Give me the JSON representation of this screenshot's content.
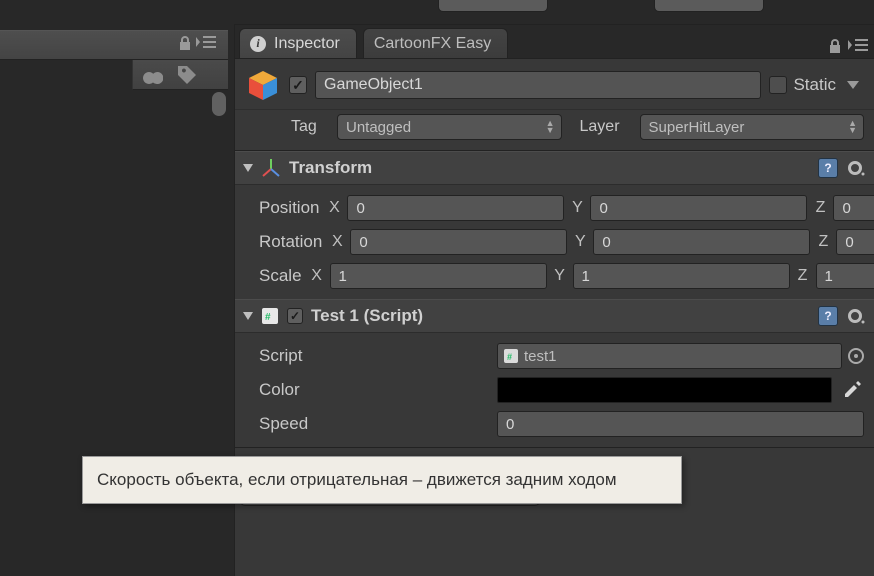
{
  "tabs": {
    "inspector": "Inspector",
    "fx": "CartoonFX Easy"
  },
  "header": {
    "active_checked": true,
    "name": "GameObject1",
    "static_label": "Static",
    "static_checked": false
  },
  "taglayer": {
    "tag_label": "Tag",
    "tag_value": "Untagged",
    "layer_label": "Layer",
    "layer_value": "SuperHitLayer"
  },
  "transform": {
    "title": "Transform",
    "position_label": "Position",
    "rotation_label": "Rotation",
    "scale_label": "Scale",
    "axes": {
      "x": "X",
      "y": "Y",
      "z": "Z"
    },
    "position": {
      "x": "0",
      "y": "0",
      "z": "0"
    },
    "rotation": {
      "x": "0",
      "y": "0",
      "z": "0"
    },
    "scale": {
      "x": "1",
      "y": "1",
      "z": "1"
    }
  },
  "script": {
    "title": "Test 1 (Script)",
    "enabled": true,
    "script_label": "Script",
    "script_value": "test1",
    "color_label": "Color",
    "color_value": "#000000",
    "speed_label": "Speed",
    "speed_value": "0"
  },
  "tooltip": "Скорость объекта, если отрицательная – движется задним ходом"
}
